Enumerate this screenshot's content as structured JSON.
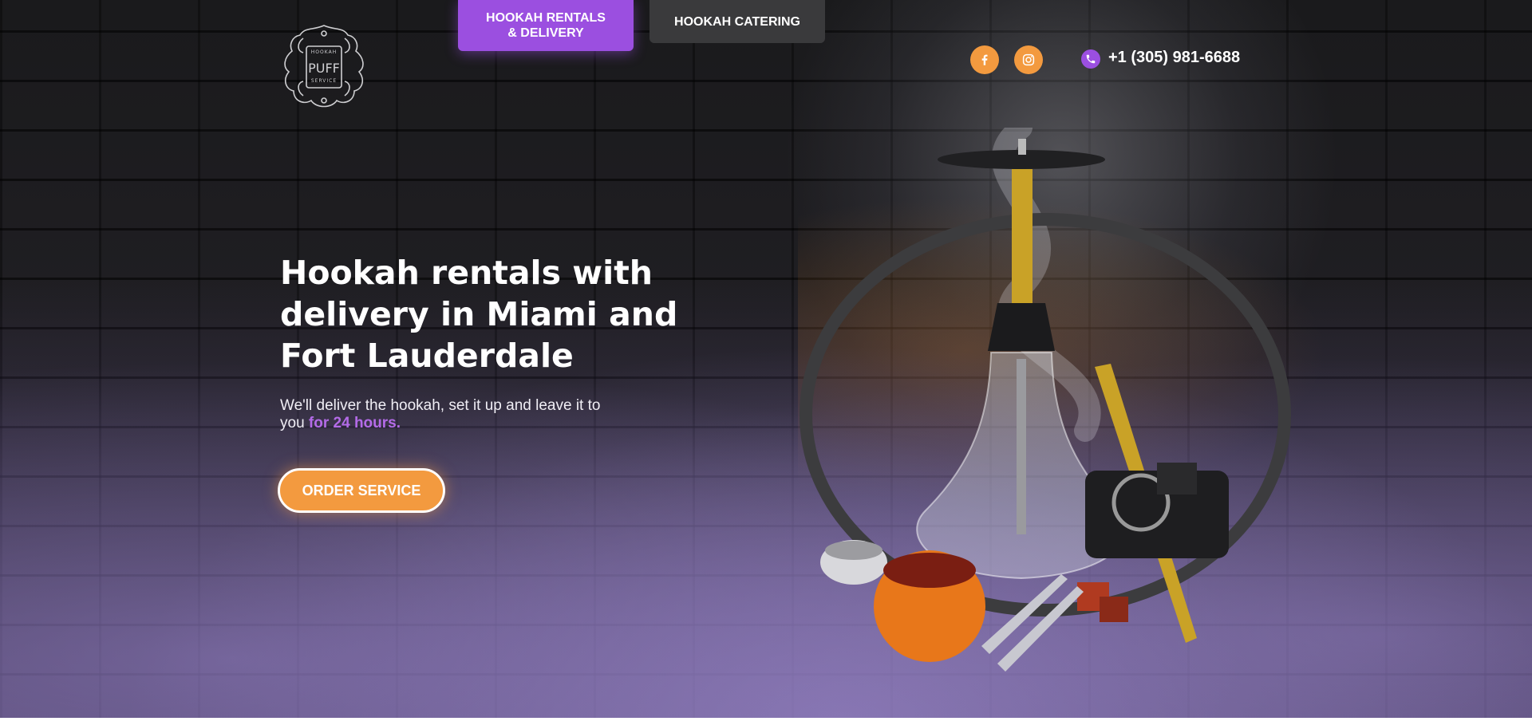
{
  "logo": {
    "top_text": "HOOKAH",
    "brand": "PUFF",
    "bottom_text": "SERVICE"
  },
  "nav": {
    "tabs": [
      {
        "line1": "HOOKAH RENTALS",
        "line2": "& DELIVERY",
        "active": true
      },
      {
        "line1": "HOOKAH CATERING",
        "active": false
      }
    ]
  },
  "header": {
    "social": [
      {
        "icon": "facebook-icon",
        "color": "#f39a3f"
      },
      {
        "icon": "instagram-icon",
        "color": "#f39a3f"
      }
    ],
    "phone": "+1 (305) 981-6688"
  },
  "hero": {
    "title": "Hookah rentals with delivery in Miami and Fort Lauderdale",
    "subtitle_prefix": "We'll deliver the hookah, set it up and leave it to you ",
    "subtitle_highlight": "for 24 hours.",
    "cta_label": "ORDER SERVICE"
  },
  "colors": {
    "accent_purple": "#9b4fe0",
    "accent_orange": "#f39a3f",
    "inactive_tab": "#3a3a3c",
    "background": "#141416"
  }
}
